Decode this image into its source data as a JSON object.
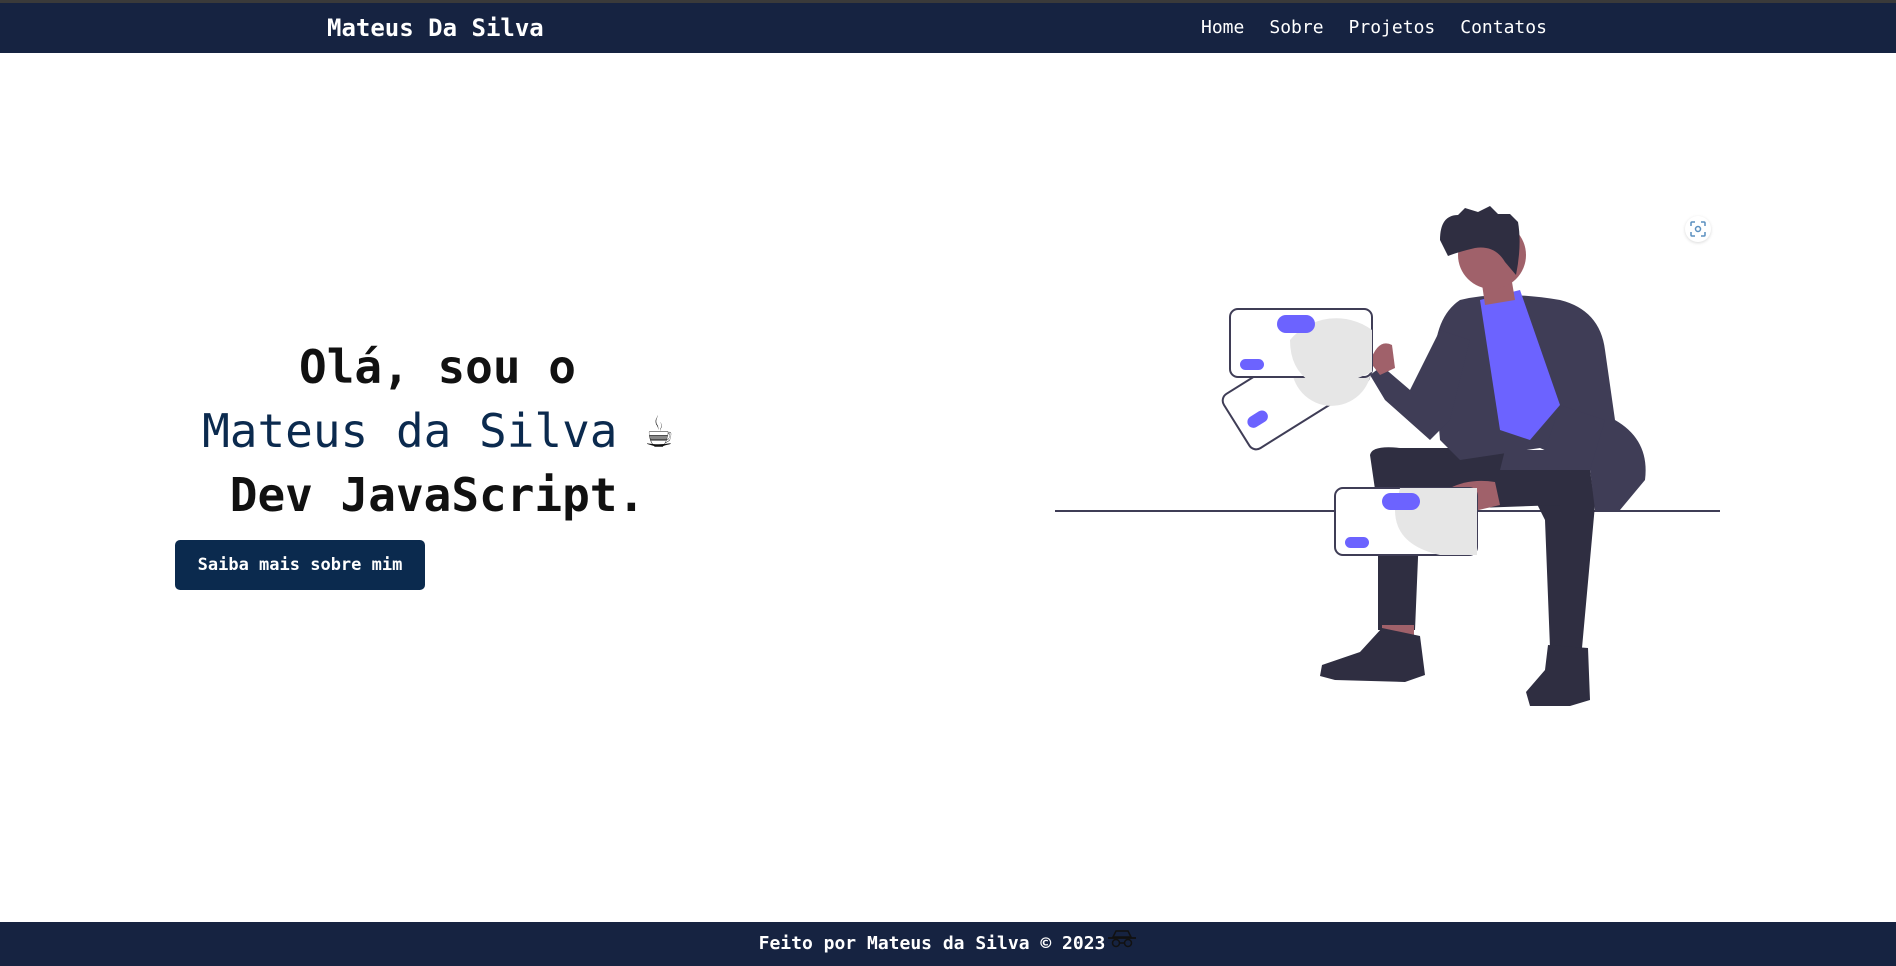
{
  "navbar": {
    "brand": "Mateus Da Silva",
    "links": [
      "Home",
      "Sobre",
      "Projetos",
      "Contatos"
    ]
  },
  "hero": {
    "greeting": "Olá, sou o",
    "name": "Mateus da Silva",
    "emoji": "☕",
    "role": "Dev JavaScript.",
    "cta_label": "Saiba mais sobre mim"
  },
  "illustration": {
    "icon": "person-with-devices-illustration",
    "accent_color": "#6c63ff"
  },
  "focus_button": {
    "icon": "focus-scan-icon"
  },
  "footer": {
    "text": "Feito por Mateus da Silva © 2023",
    "icon": "spy-glasses-icon"
  },
  "colors": {
    "navbar": "#162341",
    "primary": "#0b2a4e",
    "accent": "#6c63ff"
  }
}
